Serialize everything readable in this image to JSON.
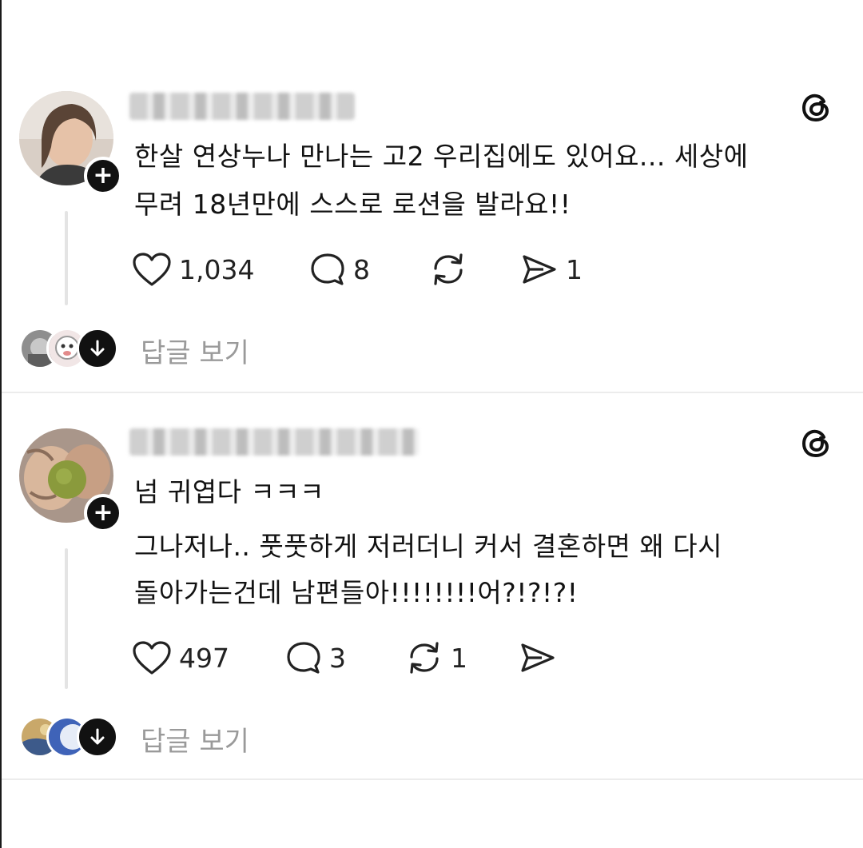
{
  "posts": [
    {
      "text_lines": [
        "한살 연상누나 만나는 고2 우리집에도 있어요... 세상에",
        "무려 18년만에 스스로 로션을 발라요!!"
      ],
      "likes": "1,034",
      "comments": "8",
      "reposts": "",
      "shares": "1",
      "view_replies_label": "답글 보기"
    },
    {
      "text_lines": [
        "넘 귀엽다 ㅋㅋㅋ",
        "그나저나.. 풋풋하게 저러더니 커서 결혼하면 왜 다시",
        "돌아가는건데 남편들아!!!!!!!!어?!?!?!"
      ],
      "likes": "497",
      "comments": "3",
      "reposts": "1",
      "shares": "",
      "view_replies_label": "답글 보기"
    }
  ],
  "icons": {
    "like": "heart-icon",
    "comment": "comment-bubble-icon",
    "repost": "repost-icon",
    "share": "send-icon",
    "follow": "plus-icon",
    "logo": "threads-logo-icon",
    "expand": "arrow-down-icon"
  },
  "colors": {
    "text": "#121212",
    "muted": "#9a9a9a",
    "badge": "#111111",
    "divider": "#ececec"
  }
}
